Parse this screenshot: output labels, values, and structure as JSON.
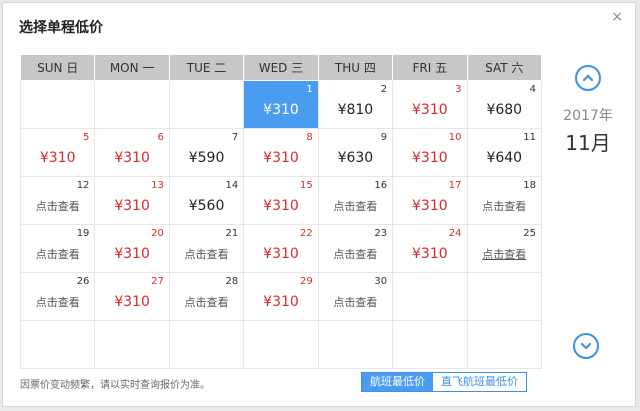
{
  "title": "选择单程低价",
  "close": "×",
  "weekdays": [
    "SUN 日",
    "MON 一",
    "TUE 二",
    "WED 三",
    "THU 四",
    "FRI 五",
    "SAT 六"
  ],
  "year": "2017年",
  "month": "11月",
  "note": "因票价变动频繁，请以实时查询报价为准。",
  "toggle": {
    "left": "航班最低价",
    "right": "直飞航班最低价"
  },
  "weeks": [
    [
      {
        "day": "",
        "price": ""
      },
      {
        "day": "",
        "price": ""
      },
      {
        "day": "",
        "price": ""
      },
      {
        "day": "1",
        "price": "¥310",
        "red": true,
        "selected": true
      },
      {
        "day": "2",
        "price": "¥810"
      },
      {
        "day": "3",
        "price": "¥310",
        "red": true
      },
      {
        "day": "4",
        "price": "¥680"
      }
    ],
    [
      {
        "day": "5",
        "price": "¥310",
        "red": true
      },
      {
        "day": "6",
        "price": "¥310",
        "red": true
      },
      {
        "day": "7",
        "price": "¥590"
      },
      {
        "day": "8",
        "price": "¥310",
        "red": true
      },
      {
        "day": "9",
        "price": "¥630"
      },
      {
        "day": "10",
        "price": "¥310",
        "red": true
      },
      {
        "day": "11",
        "price": "¥640"
      }
    ],
    [
      {
        "day": "12",
        "look": "点击查看"
      },
      {
        "day": "13",
        "price": "¥310",
        "red": true
      },
      {
        "day": "14",
        "price": "¥560"
      },
      {
        "day": "15",
        "price": "¥310",
        "red": true
      },
      {
        "day": "16",
        "look": "点击查看"
      },
      {
        "day": "17",
        "price": "¥310",
        "red": true
      },
      {
        "day": "18",
        "look": "点击查看"
      }
    ],
    [
      {
        "day": "19",
        "look": "点击查看"
      },
      {
        "day": "20",
        "price": "¥310",
        "red": true
      },
      {
        "day": "21",
        "look": "点击查看"
      },
      {
        "day": "22",
        "price": "¥310",
        "red": true
      },
      {
        "day": "23",
        "look": "点击查看"
      },
      {
        "day": "24",
        "price": "¥310",
        "red": true
      },
      {
        "day": "25",
        "look": "点击查看",
        "underline": true
      }
    ],
    [
      {
        "day": "26",
        "look": "点击查看"
      },
      {
        "day": "27",
        "price": "¥310",
        "red": true
      },
      {
        "day": "28",
        "look": "点击查看"
      },
      {
        "day": "29",
        "price": "¥310",
        "red": true
      },
      {
        "day": "30",
        "look": "点击查看"
      },
      {
        "day": "",
        "price": ""
      },
      {
        "day": "",
        "price": ""
      }
    ],
    [
      {
        "day": "",
        "price": ""
      },
      {
        "day": "",
        "price": ""
      },
      {
        "day": "",
        "price": ""
      },
      {
        "day": "",
        "price": ""
      },
      {
        "day": "",
        "price": ""
      },
      {
        "day": "",
        "price": ""
      },
      {
        "day": "",
        "price": ""
      }
    ]
  ]
}
